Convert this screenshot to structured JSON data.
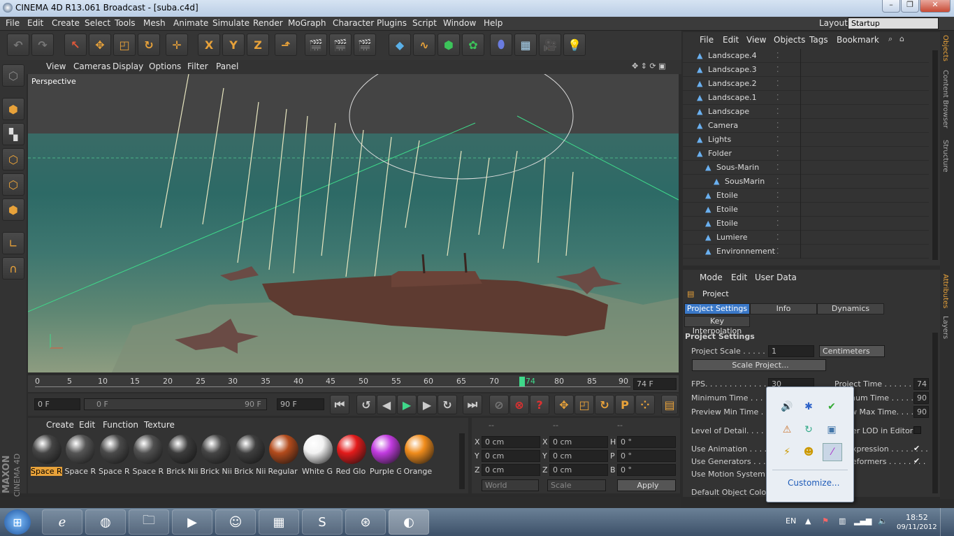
{
  "window": {
    "title": "CINEMA 4D R13.061 Broadcast - [suba.c4d]",
    "layout_label": "Layout:",
    "layout_value": "Startup"
  },
  "menubar": [
    "File",
    "Edit",
    "Create",
    "Select",
    "Tools",
    "Mesh",
    "Animate",
    "Simulate",
    "Render",
    "MoGraph",
    "Character",
    "Plugins",
    "Script",
    "Window",
    "Help"
  ],
  "toolbar": {
    "axis_x": "X",
    "axis_y": "Y",
    "axis_z": "Z"
  },
  "viewport": {
    "menu": [
      "View",
      "Cameras",
      "Display",
      "Options",
      "Filter",
      "Panel"
    ],
    "label": "Perspective"
  },
  "timeline": {
    "ticks": [
      "0",
      "5",
      "10",
      "15",
      "20",
      "25",
      "30",
      "35",
      "40",
      "45",
      "50",
      "55",
      "60",
      "65",
      "70",
      "74",
      "80",
      "85",
      "90"
    ],
    "current_frame": "74 F"
  },
  "transport": {
    "start": "0 F",
    "range_start": "0 F",
    "range_end": "90 F",
    "end": "90 F"
  },
  "material_panel": {
    "menu": [
      "Create",
      "Edit",
      "Function",
      "Texture"
    ],
    "materials": [
      {
        "name": "Space R",
        "color": "#444"
      },
      {
        "name": "Space R",
        "color": "#555"
      },
      {
        "name": "Space R",
        "color": "#4a4a4a"
      },
      {
        "name": "Space R",
        "color": "#505050"
      },
      {
        "name": "Brick Nii",
        "color": "#3c3c3c"
      },
      {
        "name": "Brick Nii",
        "color": "#454545"
      },
      {
        "name": "Brick Nii",
        "color": "#3f3f3f"
      },
      {
        "name": "Regular",
        "color": "#b34b1c"
      },
      {
        "name": "White G",
        "color": "#f2f2f2"
      },
      {
        "name": "Red Glo",
        "color": "#e31b1b"
      },
      {
        "name": "Purple G",
        "color": "#c23be0"
      },
      {
        "name": "Orange",
        "color": "#f08c1c"
      }
    ]
  },
  "coords": {
    "headers": [
      "--",
      "--",
      "--"
    ],
    "rows": [
      [
        "X",
        "0 cm",
        "X",
        "0 cm",
        "H",
        "0 °"
      ],
      [
        "Y",
        "0 cm",
        "Y",
        "0 cm",
        "P",
        "0 °"
      ],
      [
        "Z",
        "0 cm",
        "Z",
        "0 cm",
        "B",
        "0 °"
      ]
    ],
    "mode1": "World",
    "mode2": "Scale",
    "apply": "Apply"
  },
  "object_manager": {
    "menu": [
      "File",
      "Edit",
      "View",
      "Objects",
      "Tags",
      "Bookmark"
    ],
    "objects": [
      {
        "name": "Landscape.4",
        "indent": 0
      },
      {
        "name": "Landscape.3",
        "indent": 0
      },
      {
        "name": "Landscape.2",
        "indent": 0
      },
      {
        "name": "Landscape.1",
        "indent": 0
      },
      {
        "name": "Landscape",
        "indent": 0
      },
      {
        "name": "Camera",
        "indent": 0
      },
      {
        "name": "Lights",
        "indent": 0
      },
      {
        "name": "Folder",
        "indent": 0
      },
      {
        "name": "Sous-Marin",
        "indent": 1
      },
      {
        "name": "SousMarin",
        "indent": 2
      },
      {
        "name": "Etoile",
        "indent": 1
      },
      {
        "name": "Etoile",
        "indent": 1
      },
      {
        "name": "Etoile",
        "indent": 1
      },
      {
        "name": "Lumiere",
        "indent": 1
      },
      {
        "name": "Environnement",
        "indent": 1
      }
    ]
  },
  "attributes": {
    "menu": [
      "Mode",
      "Edit",
      "User Data"
    ],
    "object": "Project",
    "tabs": [
      "Project Settings",
      "Info",
      "Dynamics"
    ],
    "tab2": "Key Interpolation",
    "section": "Project Settings",
    "scale_label": "Project Scale . . . . . . . .",
    "scale_value": "1",
    "scale_unit": "Centimeters",
    "scale_button": "Scale Project...",
    "fps_label": "FPS. . . . . . . . . . . . . . . .",
    "fps_value": "30",
    "ptime_label": "Project Time . . . . . . . .",
    "ptime_value": "74",
    "min_label": "Minimum Time . . . . . . .",
    "max_frag": "num Time . . . . . . . .",
    "max_value": "90",
    "pmin_label": "Preview Min Time . . . .",
    "pmax_frag": "w Max Time. . . . . . .",
    "pmax_value": "90",
    "lod_label": "Level of Detail. . . . . . .",
    "lod_frag": "er LOD in Editor",
    "anim_label": "Use Animation . . . . . . . .",
    "expr_frag": "xpression . . . . . . . .",
    "gen_label": "Use Generators . . . . . . .",
    "def_frag": "eformers . . . . . . . .",
    "motion_label": "Use Motion System",
    "color_label": "Default Object Color"
  },
  "sidetabs": [
    "Objects",
    "Content Browser",
    "Structure",
    "Attributes",
    "Layers"
  ],
  "brand": {
    "maxon": "MAXON",
    "c4d": "CINEMA 4D"
  },
  "tray_popup": {
    "customize": "Customize..."
  },
  "taskbar": {
    "lang": "EN",
    "time": "18:52",
    "date": "09/11/2012"
  }
}
